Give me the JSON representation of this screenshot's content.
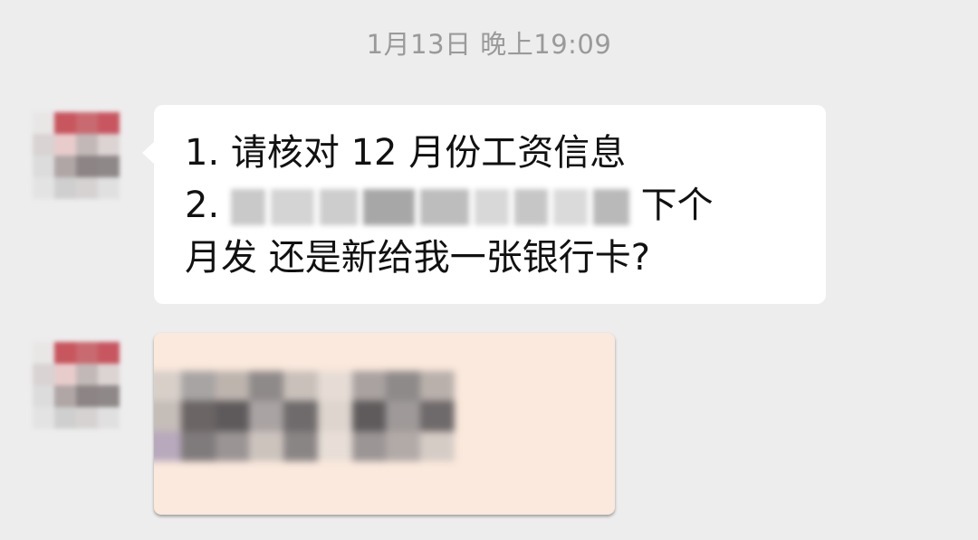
{
  "chat": {
    "timestamp": "1月13日 晚上19:09",
    "messages": [
      {
        "type": "text",
        "line1": "1. 请核对 12 月份工资信息",
        "line2_prefix": "2.",
        "line2_suffix": "下个",
        "line3": "月发 还是新给我一张银行卡?"
      },
      {
        "type": "image",
        "content": "redacted image"
      }
    ]
  },
  "colors": {
    "background": "#ededed",
    "bubble": "#ffffff",
    "image_bubble": "#fbe9dd",
    "timestamp": "#9a9a9a",
    "text": "#111111",
    "avatar_accent": "#c8565e"
  }
}
